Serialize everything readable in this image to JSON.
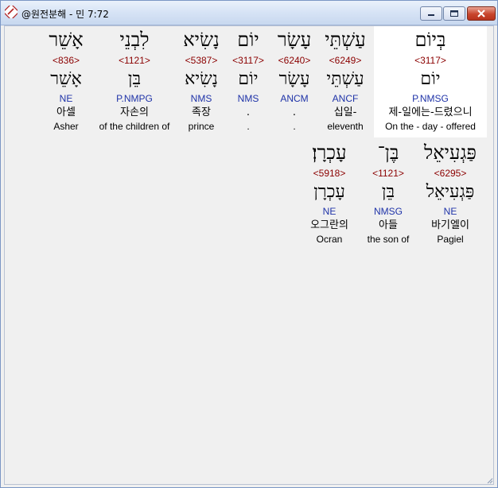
{
  "window": {
    "title": "@원전분해 - 민 7:72"
  },
  "row1": [
    {
      "heb": "בְּיוֹם",
      "num": "<3117>",
      "heb2": "יוֹם",
      "morph": "P.NMSG",
      "kor": "제-일에는-드렸으니",
      "eng": "On the - day - offered"
    },
    {
      "heb": "עַשְׁתֵּי",
      "num": "<6249>",
      "heb2": "עַשְׁתֵּי",
      "morph": "ANCF",
      "kor": "십일-",
      "eng": "eleventh"
    },
    {
      "heb": "עָשָׂר",
      "num": "<6240>",
      "heb2": "עָשָׂר",
      "morph": "ANCM",
      "kor": ".",
      "eng": "."
    },
    {
      "heb": "יוֹם",
      "num": "<3117>",
      "heb2": "יוֹם",
      "morph": "NMS",
      "kor": ".",
      "eng": "."
    },
    {
      "heb": "נָשִׂיא",
      "num": "<5387>",
      "heb2": "נָשִׂיא",
      "morph": "NMS",
      "kor": "족장",
      "eng": "prince"
    },
    {
      "heb": "לִבְנֵי",
      "num": "<1121>",
      "heb2": "בֵּן",
      "morph": "P.NMPG",
      "kor": "자손의",
      "eng": "of the children of"
    },
    {
      "heb": "אָשֵׁר",
      "num": "<836>",
      "heb2": "אָשֵׁר",
      "morph": "NE",
      "kor": "아셀",
      "eng": "Asher"
    }
  ],
  "row2": [
    {
      "heb": "פַּגְעִיאֵל",
      "num": "<6295>",
      "heb2": "פַּגְעִיאֵל",
      "morph": "NE",
      "kor": "바기엘이",
      "eng": "Pagiel"
    },
    {
      "heb": "בֶּן־",
      "num": "<1121>",
      "heb2": "בֵּן",
      "morph": "NMSG",
      "kor": "아들",
      "eng": "the son of"
    },
    {
      "heb": "עָכְרָן׃",
      "num": "<5918>",
      "heb2": "עָכְרָן",
      "morph": "NE",
      "kor": "오그란의",
      "eng": "Ocran"
    }
  ]
}
